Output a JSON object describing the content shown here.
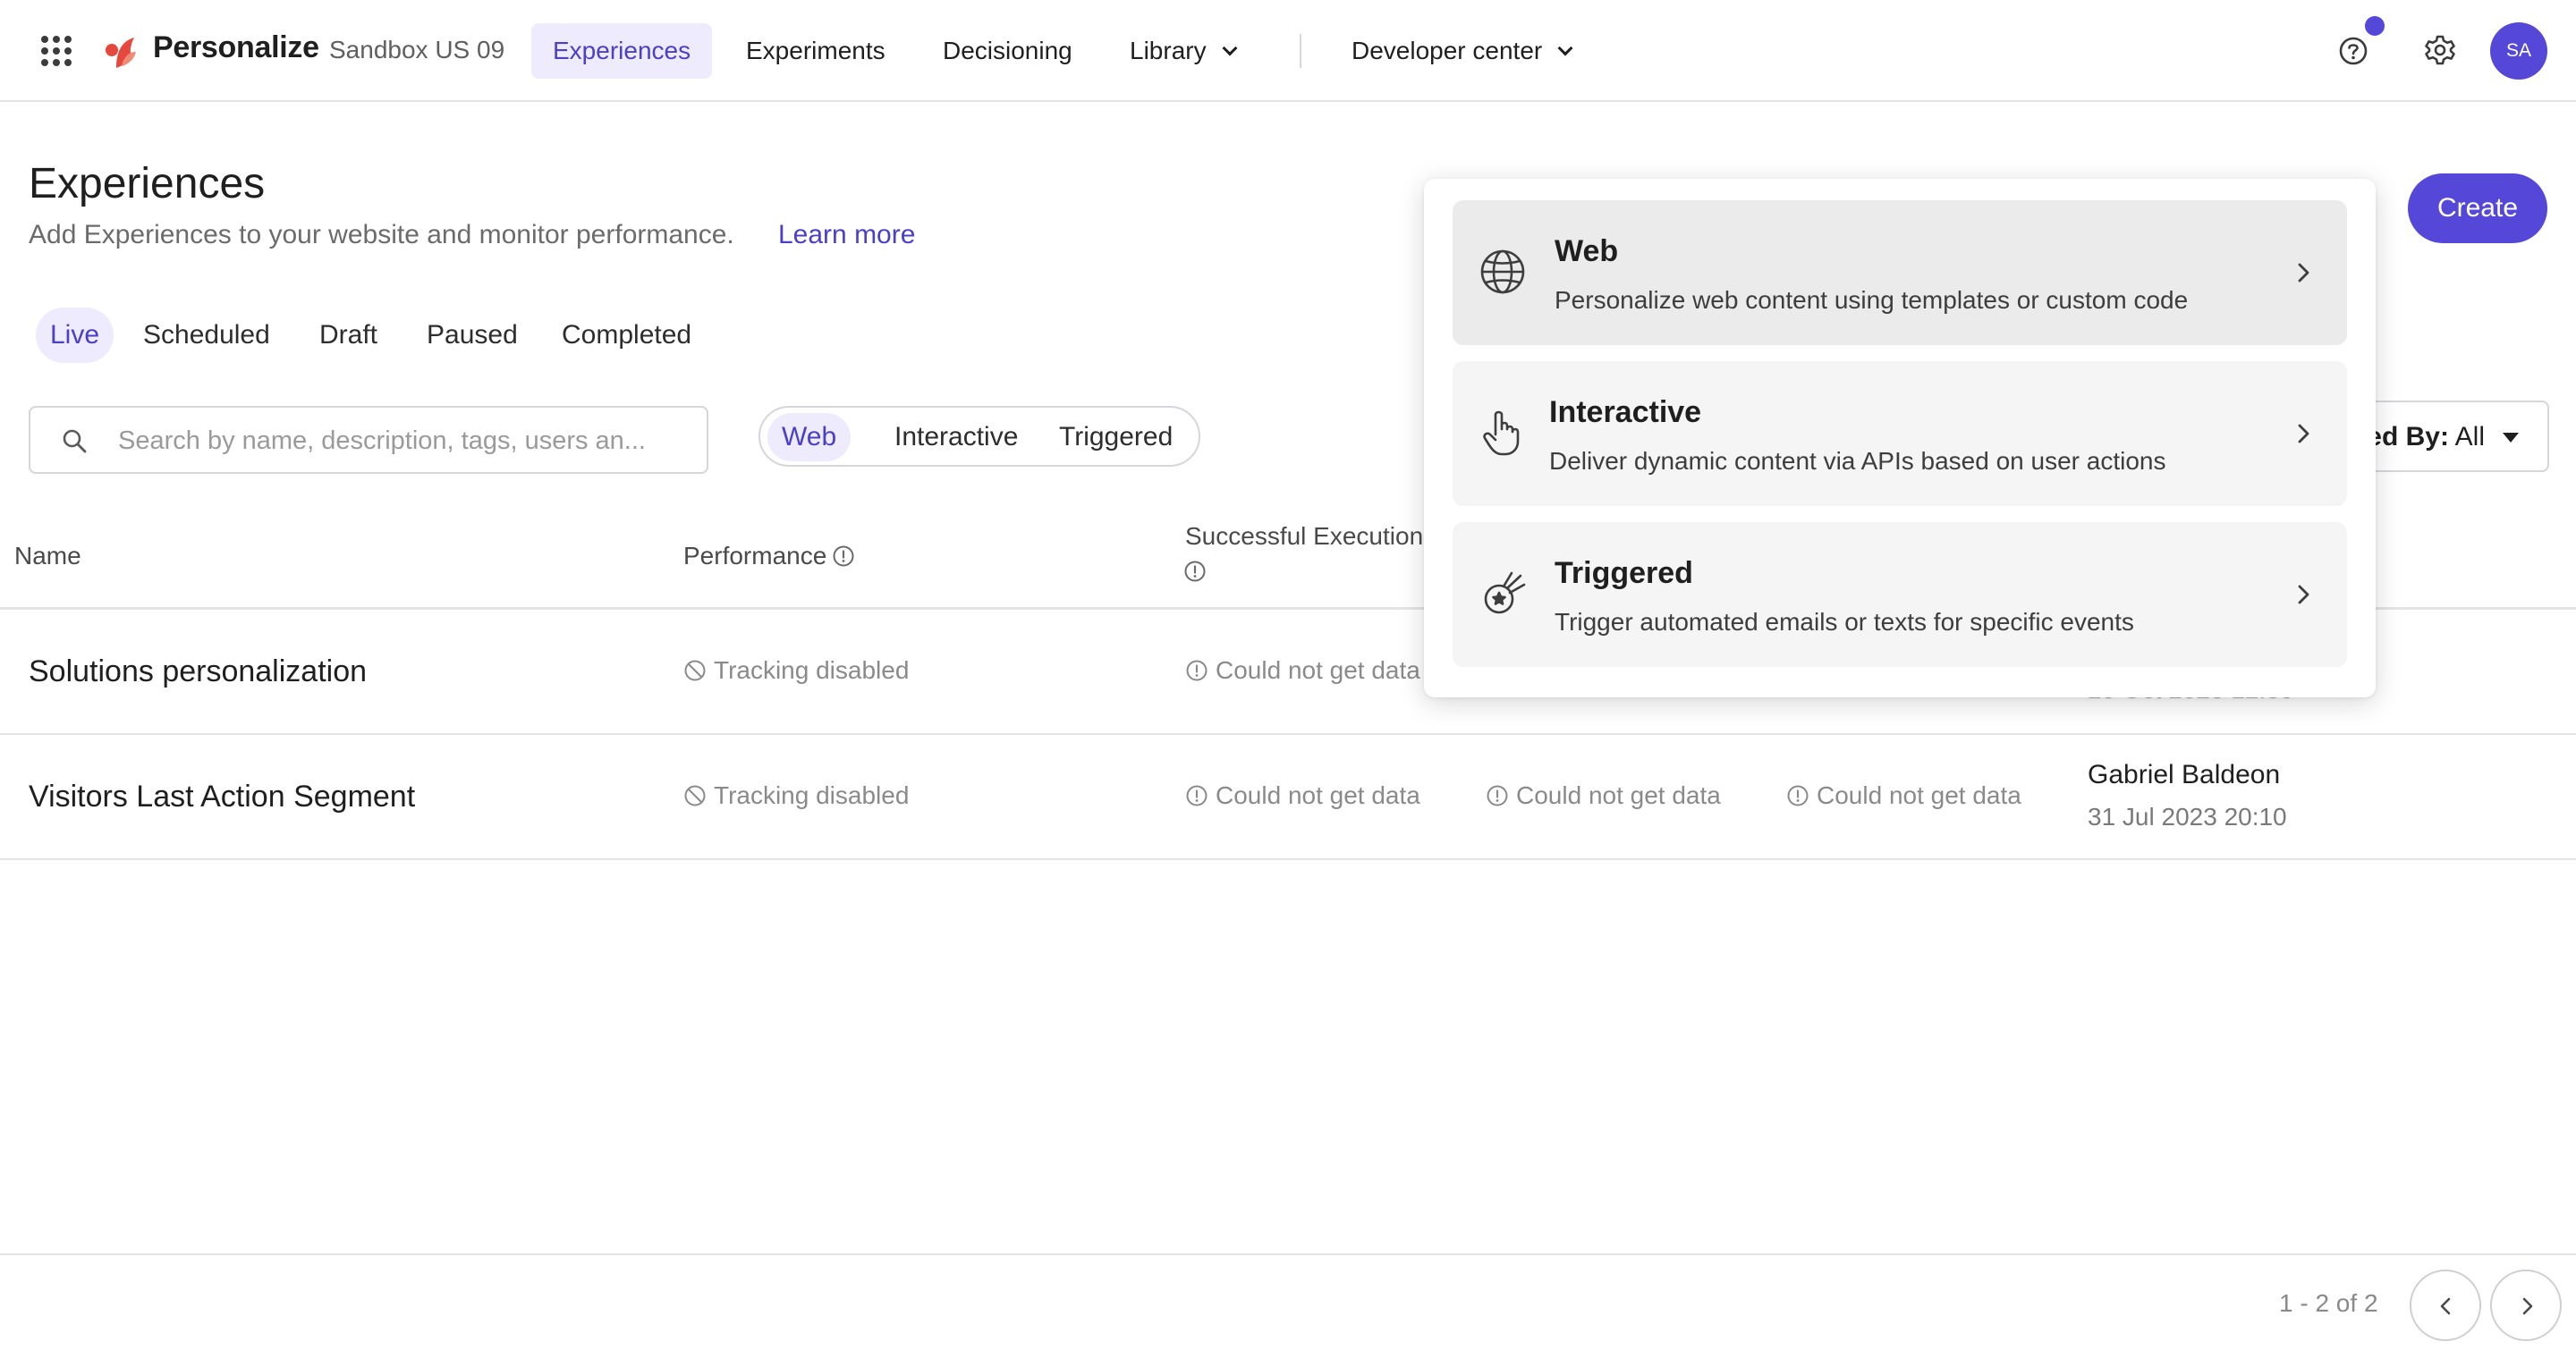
{
  "topnav": {
    "brand": "Personalize",
    "tenant": "Sandbox US 09",
    "items": [
      {
        "label": "Experiences",
        "active": true
      },
      {
        "label": "Experiments"
      },
      {
        "label": "Decisioning"
      },
      {
        "label": "Library",
        "has_dropdown": true
      },
      {
        "label": "Developer center",
        "has_dropdown": true
      }
    ],
    "avatar_initials": "SA",
    "icons": [
      "app-launcher-icon",
      "help-icon",
      "settings-gear-icon"
    ],
    "accent_color": "#5548d9"
  },
  "header": {
    "title": "Experiences",
    "subtitle": "Add Experiences to your website and monitor performance.",
    "learn_more": "Learn more",
    "create_label": "Create"
  },
  "status_tabs": [
    {
      "label": "Live",
      "active": true
    },
    {
      "label": "Scheduled"
    },
    {
      "label": "Draft"
    },
    {
      "label": "Paused"
    },
    {
      "label": "Completed"
    }
  ],
  "search": {
    "placeholder": "Search by name, description, tags, users an..."
  },
  "type_filter": [
    {
      "label": "Web",
      "active": true
    },
    {
      "label": "Interactive"
    },
    {
      "label": "Triggered"
    }
  ],
  "created_by": {
    "visible_label": "ed By:",
    "value": "All"
  },
  "table": {
    "columns": [
      {
        "label": "Name"
      },
      {
        "label": "Performance",
        "info": true
      },
      {
        "label": "Successful Execution",
        "info": true
      }
    ],
    "rows": [
      {
        "name": "Solutions personalization",
        "performance": "Tracking disabled",
        "executions": "Could not get data",
        "date_partial": "20 Oct 2023 12:30"
      },
      {
        "name": "Visitors Last Action Segment",
        "performance": "Tracking disabled",
        "executions": "Could not get data",
        "col4": "Could not get data",
        "col5": "Could not get data",
        "user": "Gabriel Baldeon",
        "date": "31 Jul 2023 20:10"
      }
    ]
  },
  "pagination": {
    "range": "1 - 2 of 2"
  },
  "create_menu": {
    "options": [
      {
        "title": "Web",
        "description": "Personalize web content using templates or custom code",
        "icon": "globe-icon"
      },
      {
        "title": "Interactive",
        "description": "Deliver dynamic content via APIs based on user actions",
        "icon": "pointer-hand-icon"
      },
      {
        "title": "Triggered",
        "description": "Trigger automated emails or texts for specific events",
        "icon": "comet-icon"
      }
    ]
  }
}
